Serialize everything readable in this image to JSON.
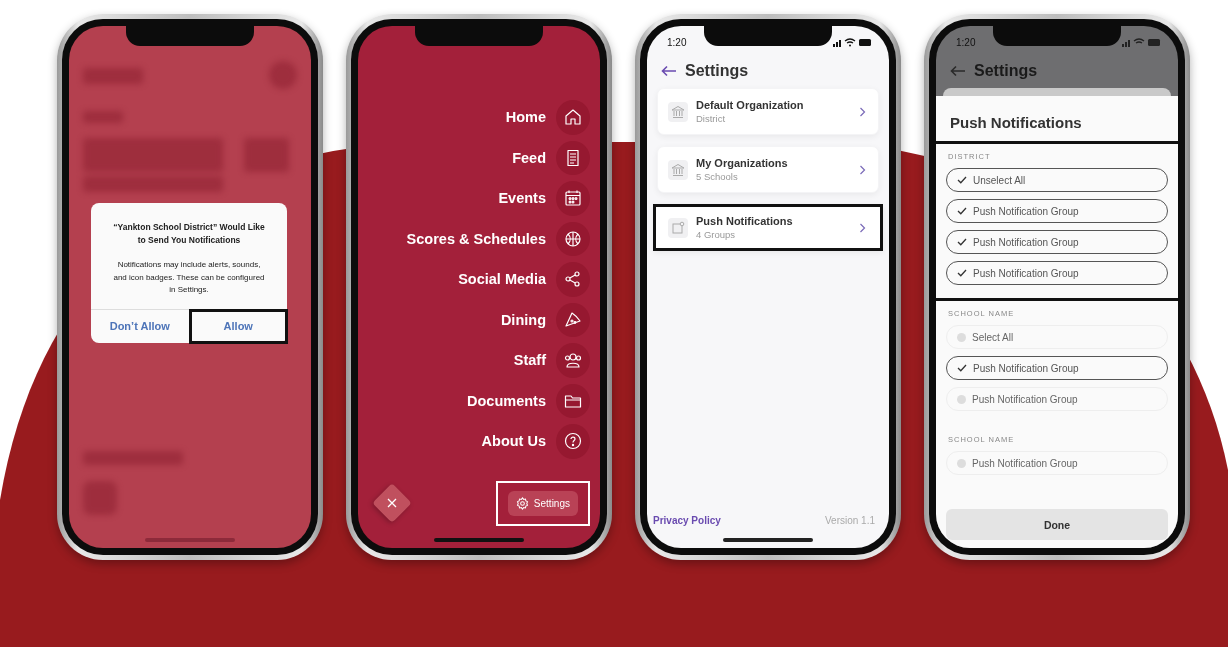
{
  "phones": [
    {
      "kind": "alert",
      "alert": {
        "title": "“Yankton School District” Would Like to Send You Notifications",
        "message": "Notifications may include alerts, sounds, and icon badges. These can be configured in Settings.",
        "buttons": [
          {
            "label": "Don’t Allow",
            "highlighted": false
          },
          {
            "label": "Allow",
            "highlighted": true
          }
        ]
      }
    },
    {
      "kind": "menu",
      "items": [
        {
          "label": "Home"
        },
        {
          "label": "Feed"
        },
        {
          "label": "Events"
        },
        {
          "label": "Scores & Schedules"
        },
        {
          "label": "Social Media"
        },
        {
          "label": "Dining"
        },
        {
          "label": "Staff"
        },
        {
          "label": "Documents"
        },
        {
          "label": "About Us"
        }
      ],
      "settings_button": {
        "label": "Settings",
        "highlighted": true
      }
    },
    {
      "kind": "settings",
      "status_time": "1:20",
      "title": "Settings",
      "rows": [
        {
          "title": "Default Organization",
          "subtitle": "District",
          "highlighted": false
        },
        {
          "title": "My Organizations",
          "subtitle": "5 Schools",
          "highlighted": false
        },
        {
          "title": "Push Notifications",
          "subtitle": "4 Groups",
          "highlighted": true
        }
      ],
      "footer_link": "Privacy Policy",
      "version": "Version 1.1"
    },
    {
      "kind": "sheet",
      "status_time": "1:20",
      "back_title": "Settings",
      "title": "Push Notifications",
      "sections": [
        {
          "heading": "DISTRICT",
          "highlighted": true,
          "options": [
            {
              "label": "Unselect All",
              "checked": true
            },
            {
              "label": "Push Notification Group",
              "checked": true
            },
            {
              "label": "Push Notification Group",
              "checked": true
            },
            {
              "label": "Push Notification Group",
              "checked": true
            }
          ]
        },
        {
          "heading": "SCHOOL NAME",
          "highlighted": false,
          "options": [
            {
              "label": "Select All",
              "checked": false
            },
            {
              "label": "Push Notification Group",
              "checked": true
            },
            {
              "label": "Push Notification Group",
              "checked": false
            }
          ]
        },
        {
          "heading": "SCHOOL NAME",
          "highlighted": false,
          "options": [
            {
              "label": "Push Notification Group",
              "checked": false
            }
          ]
        }
      ],
      "done": "Done"
    }
  ]
}
